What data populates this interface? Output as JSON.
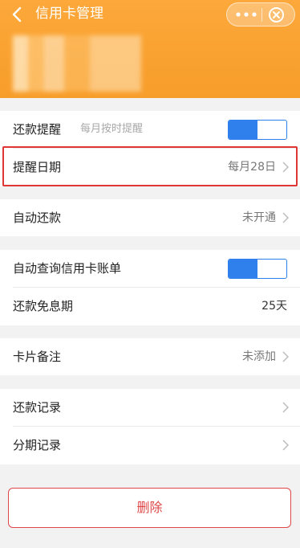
{
  "header": {
    "title": "信用卡管理",
    "accent_color": "#f79d2a",
    "icons": {
      "back": "back-chevron-icon",
      "more": "more-dots-icon",
      "close": "close-circle-icon"
    }
  },
  "rows": {
    "repay_reminder": {
      "label": "还款提醒",
      "sublabel": "每月按时提醒",
      "toggle_on": true
    },
    "reminder_date": {
      "label": "提醒日期",
      "value": "每月28日"
    },
    "auto_repay": {
      "label": "自动还款",
      "value": "未开通"
    },
    "auto_query": {
      "label": "自动查询信用卡账单",
      "toggle_on": true
    },
    "interest_free": {
      "label": "还款免息期",
      "value": "25天"
    },
    "card_note": {
      "label": "卡片备注",
      "value": "未添加"
    },
    "repay_history": {
      "label": "还款记录"
    },
    "installment_history": {
      "label": "分期记录"
    }
  },
  "delete_button": {
    "label": "删除",
    "color": "#e04848"
  },
  "toggle_color": "#2f80ed",
  "highlight_color": "#e03535"
}
